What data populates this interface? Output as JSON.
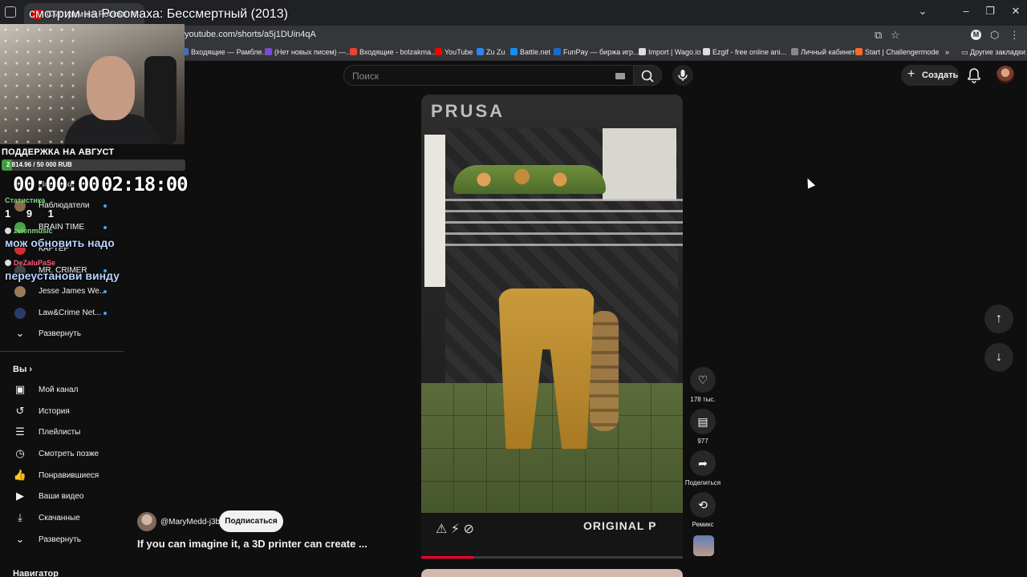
{
  "browser": {
    "tab_title": "Смотрим на Росомаха",
    "url": "youtube.com/shorts/a5j1DUin4qA",
    "bookmarks": [
      {
        "label": "Входящие — Рамбле...",
        "color": "#3b6fd1"
      },
      {
        "label": "(Нет новых писем) —...",
        "color": "#7b4bd4"
      },
      {
        "label": "Входящие - bolzakma...",
        "color": "#ea4335"
      },
      {
        "label": "YouTube",
        "color": "#ff0000"
      },
      {
        "label": "Zu Zu",
        "color": "#2787f5"
      },
      {
        "label": "Battle.net",
        "color": "#148eff"
      },
      {
        "label": "FunPay — биржа игр...",
        "color": "#1b6ad1"
      },
      {
        "label": "Import | Wago.io",
        "color": "#dddddd"
      },
      {
        "label": "Ezgif - free online ani...",
        "color": "#dddddd"
      },
      {
        "label": "Личный кабинет",
        "color": "#888888"
      },
      {
        "label": "Start | Challengermode",
        "color": "#ff6a2c"
      }
    ],
    "other_bookmarks": "Другие закладки"
  },
  "stream_overlay": {
    "title": "смотрим на Росомаха: Бессмертный (2013)",
    "donation_label": "ПОДДЕРЖКА НА АВГУСТ",
    "donation_amount": "2 814.96 / 50 000 RUB",
    "donation_progress": 0.056,
    "timer_left": "00:00:00",
    "timer_right": "02:18:00",
    "stats_label": "Статистика",
    "stats_values": "1  9  1",
    "chat": [
      {
        "user": "zelenmusic",
        "color": "#7fd67f",
        "message": "мож обновить надо"
      },
      {
        "user": "DeZaluPaSe",
        "color": "#ff5a7a",
        "message": "переустанови винду"
      }
    ]
  },
  "youtube": {
    "search_placeholder": "Поиск",
    "create_label": "Создать",
    "sidebar": {
      "subscriptions": [
        {
          "name": "Подписки",
          "color": "#555555",
          "dot": false
        },
        {
          "name": "Наблюдатели",
          "color": "#8a6a4a",
          "dot": true
        },
        {
          "name": "BRAIN TIME",
          "color": "#4aa04a",
          "dot": true
        },
        {
          "name": "КАРТЕР",
          "color": "#d03030",
          "dot": false
        },
        {
          "name": "MR. CRIMER",
          "color": "#444444",
          "dot": true
        },
        {
          "name": "Jesse James We...",
          "color": "#9a7a5a",
          "dot": true
        },
        {
          "name": "Law&Crime Net...",
          "color": "#2a3a6a",
          "dot": true
        }
      ],
      "expand_label": "Развернуть",
      "you_heading": "Вы",
      "you_items": [
        {
          "label": "Мой канал",
          "icon": "channel-icon",
          "glyph": "▣"
        },
        {
          "label": "История",
          "icon": "history-icon",
          "glyph": "↺"
        },
        {
          "label": "Плейлисты",
          "icon": "playlist-icon",
          "glyph": "☰"
        },
        {
          "label": "Смотреть позже",
          "icon": "watch-later-icon",
          "glyph": "◷"
        },
        {
          "label": "Понравившиеся",
          "icon": "thumb-up-icon",
          "glyph": "👍"
        },
        {
          "label": "Ваши видео",
          "icon": "your-videos-icon",
          "glyph": "▶"
        },
        {
          "label": "Скачанные",
          "icon": "download-icon",
          "glyph": "⤓"
        },
        {
          "label": "Развернуть",
          "icon": "chevron-down-icon",
          "glyph": "⌄"
        }
      ],
      "navigator_heading": "Навигатор"
    },
    "short": {
      "channel": "@MaryMedd-j3b",
      "subscribe_label": "Подписаться",
      "title": "If you can imagine it, a 3D printer can create ...",
      "printer_brand": "PRUSA",
      "printer_front": "ORIGINAL P",
      "progress": 0.2,
      "likes": "178 тыс.",
      "comments": "977",
      "share_label": "Поделиться",
      "remix_label": "Ремикс"
    }
  }
}
